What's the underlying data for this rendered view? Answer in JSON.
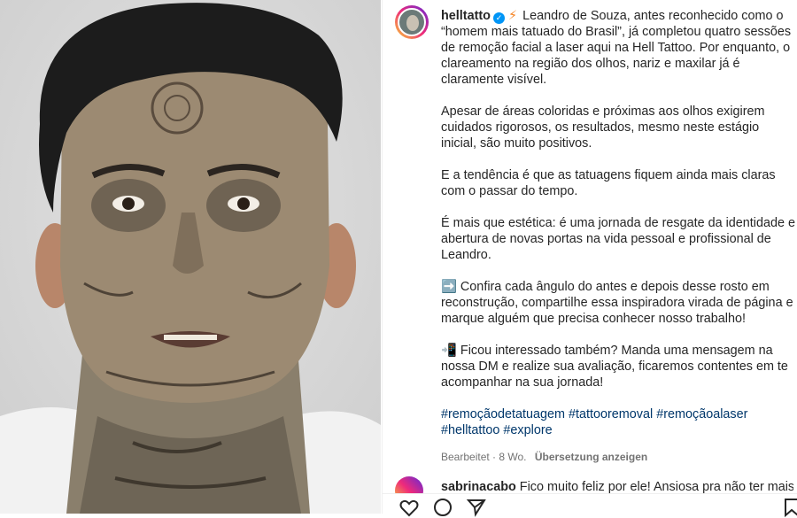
{
  "post": {
    "username": "helltatto",
    "verified_mark": "✓",
    "bolt_emoji": "⚡",
    "paragraphs": [
      "Leandro de Souza, antes reconhecido como o “homem mais tatuado do Brasil”, já completou quatro sessões de remoção facial a laser aqui na Hell Tattoo. Por enquanto, o clareamento na região dos olhos, nariz e maxilar já é claramente visível.",
      "Apesar de áreas coloridas e próximas aos olhos exigirem cuidados rigorosos, os resultados, mesmo neste estágio inicial, são muito positivos.",
      "E a tendência é que as tatuagens fiquem ainda mais claras com o passar do tempo.",
      "É mais que estética: é uma jornada de resgate da identidade e abertura de novas portas na vida pessoal e profissional de Leandro.",
      "➡️ Confira cada ângulo do antes e depois desse rosto em reconstrução, compartilhe essa inspiradora virada de página e marque alguém que precisa conhecer nosso trabalho!",
      "📲 Ficou interessado também? Manda uma mensagem na nossa DM e realize sua avaliação, ficaremos contentes em te acompanhar na sua jornada!"
    ],
    "hashtags": [
      "#remoçãodetatuagem",
      "#tattooremoval",
      "#remoçãoalaser",
      "#helltattoo",
      "#explore"
    ],
    "meta": {
      "edited": "Bearbeitet · 8 Wo.",
      "translate": "Übersetzung anzeigen"
    }
  },
  "comment": {
    "username": "sabrinacabo",
    "text": "Fico muito feliz por ele! Ansiosa pra não ter mais"
  },
  "icons": {
    "like": "heart-icon",
    "comment": "comment-icon",
    "share": "send-icon",
    "save": "bookmark-icon"
  },
  "colors": {
    "link": "#00376b",
    "verified": "#0095f6",
    "meta": "#737373"
  }
}
